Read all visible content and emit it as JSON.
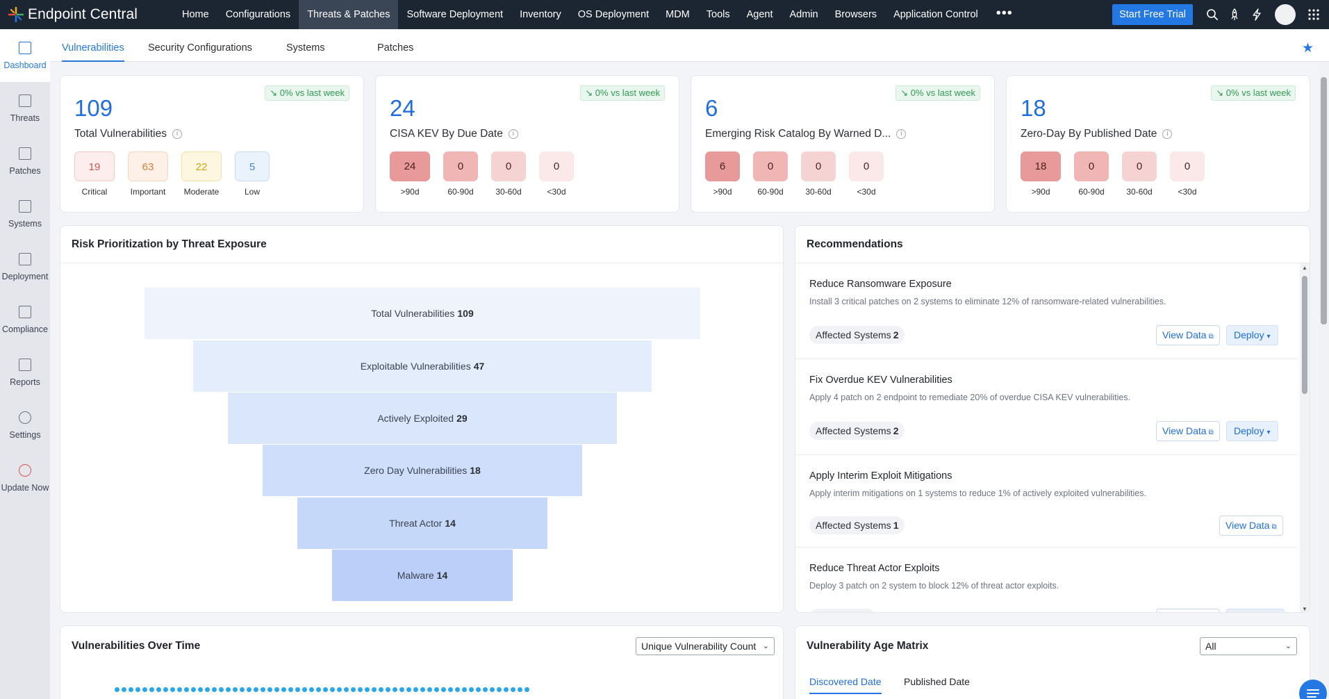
{
  "brand": {
    "name": "Endpoint Central"
  },
  "nav": [
    {
      "label": "Home",
      "active": false
    },
    {
      "label": "Configurations",
      "active": false
    },
    {
      "label": "Threats & Patches",
      "active": true
    },
    {
      "label": "Software Deployment",
      "active": false
    },
    {
      "label": "Inventory",
      "active": false
    },
    {
      "label": "OS Deployment",
      "active": false
    },
    {
      "label": "MDM",
      "active": false
    },
    {
      "label": "Tools",
      "active": false
    },
    {
      "label": "Agent",
      "active": false
    },
    {
      "label": "Admin",
      "active": false
    },
    {
      "label": "Browsers",
      "active": false
    },
    {
      "label": "Application Control",
      "active": false
    }
  ],
  "nav_more": "•••",
  "top_actions": {
    "trial_label": "Start Free Trial"
  },
  "sidebar": [
    {
      "label": "Dashboard",
      "icon": "dashboard-icon",
      "active": true
    },
    {
      "label": "Threats",
      "icon": "threats-icon",
      "active": false
    },
    {
      "label": "Patches",
      "icon": "patches-icon",
      "active": false
    },
    {
      "label": "Systems",
      "icon": "systems-icon",
      "active": false
    },
    {
      "label": "Deployment",
      "icon": "deployment-icon",
      "active": false
    },
    {
      "label": "Compliance",
      "icon": "compliance-icon",
      "active": false
    },
    {
      "label": "Reports",
      "icon": "reports-icon",
      "active": false
    },
    {
      "label": "Settings",
      "icon": "settings-icon",
      "active": false
    },
    {
      "label": "Update Now",
      "icon": "update-icon",
      "active": false
    }
  ],
  "subtabs": [
    {
      "label": "Vulnerabilities",
      "active": true
    },
    {
      "label": "Security Configurations",
      "active": false
    },
    {
      "label": "Systems",
      "active": false
    },
    {
      "label": "Patches",
      "active": false
    }
  ],
  "kpis": [
    {
      "value": "109",
      "label": "Total Vulnerabilities",
      "trend": "0% vs last week",
      "chips": [
        {
          "value": "19",
          "caption": "Critical"
        },
        {
          "value": "63",
          "caption": "Important"
        },
        {
          "value": "22",
          "caption": "Moderate"
        },
        {
          "value": "5",
          "caption": "Low"
        }
      ]
    },
    {
      "value": "24",
      "label": "CISA KEV By Due Date",
      "trend": "0% vs last week",
      "chips": [
        {
          "value": "24",
          "caption": ">90d"
        },
        {
          "value": "0",
          "caption": "60-90d"
        },
        {
          "value": "0",
          "caption": "30-60d"
        },
        {
          "value": "0",
          "caption": "<30d"
        }
      ]
    },
    {
      "value": "6",
      "label": "Emerging Risk Catalog By Warned D...",
      "trend": "0% vs last week",
      "chips": [
        {
          "value": "6",
          "caption": ">90d"
        },
        {
          "value": "0",
          "caption": "60-90d"
        },
        {
          "value": "0",
          "caption": "30-60d"
        },
        {
          "value": "0",
          "caption": "<30d"
        }
      ]
    },
    {
      "value": "18",
      "label": "Zero-Day By Published Date",
      "trend": "0% vs last week",
      "chips": [
        {
          "value": "18",
          "caption": ">90d"
        },
        {
          "value": "0",
          "caption": "60-90d"
        },
        {
          "value": "0",
          "caption": "30-60d"
        },
        {
          "value": "0",
          "caption": "<30d"
        }
      ]
    }
  ],
  "funnel": {
    "title": "Risk Prioritization by Threat Exposure",
    "stages": [
      {
        "label": "Total Vulnerabilities",
        "value": "109",
        "color": "#eef3fc"
      },
      {
        "label": "Exploitable Vulnerabilities",
        "value": "47",
        "color": "#e4edfb"
      },
      {
        "label": "Actively Exploited",
        "value": "29",
        "color": "#dae6fb"
      },
      {
        "label": "Zero Day Vulnerabilities",
        "value": "18",
        "color": "#cfdefa"
      },
      {
        "label": "Threat Actor",
        "value": "14",
        "color": "#c5d8f9"
      },
      {
        "label": "Malware",
        "value": "14",
        "color": "#bccff8"
      }
    ]
  },
  "recommendations": {
    "title": "Recommendations",
    "items": [
      {
        "title": "Reduce Ransomware Exposure",
        "desc": "Install 3 critical patches on 2 systems to eliminate 12% of ransomware-related vulnerabilities.",
        "affected_label": "Affected Systems",
        "affected_count": "2",
        "view_label": "View Data",
        "deploy_label": "Deploy"
      },
      {
        "title": "Fix Overdue KEV Vulnerabilities",
        "desc": "Apply 4 patch on 2 endpoint to remediate 20% of overdue CISA KEV vulnerabilities.",
        "affected_label": "Affected Systems",
        "affected_count": "2",
        "view_label": "View Data",
        "deploy_label": "Deploy"
      },
      {
        "title": "Apply Interim Exploit Mitigations",
        "desc": "Apply interim mitigations on 1 systems to reduce 1% of actively exploited vulnerabilities.",
        "affected_label": "Affected Systems",
        "affected_count": "1",
        "view_label": "View Data"
      },
      {
        "title": "Reduce Threat Actor Exploits",
        "desc": "Deploy 3 patch on 2 system to block 12% of threat actor exploits."
      }
    ]
  },
  "over_time": {
    "title": "Vulnerabilities Over Time",
    "select_value": "Unique Vulnerability Count"
  },
  "age_matrix": {
    "title": "Vulnerability Age Matrix",
    "select_value": "All",
    "tabs": [
      {
        "label": "Discovered Date",
        "active": true
      },
      {
        "label": "Published Date",
        "active": false
      }
    ]
  },
  "colors": {
    "accent": "#2478e3",
    "topbar": "#1c2532",
    "trend_green": "#2f9a54"
  }
}
